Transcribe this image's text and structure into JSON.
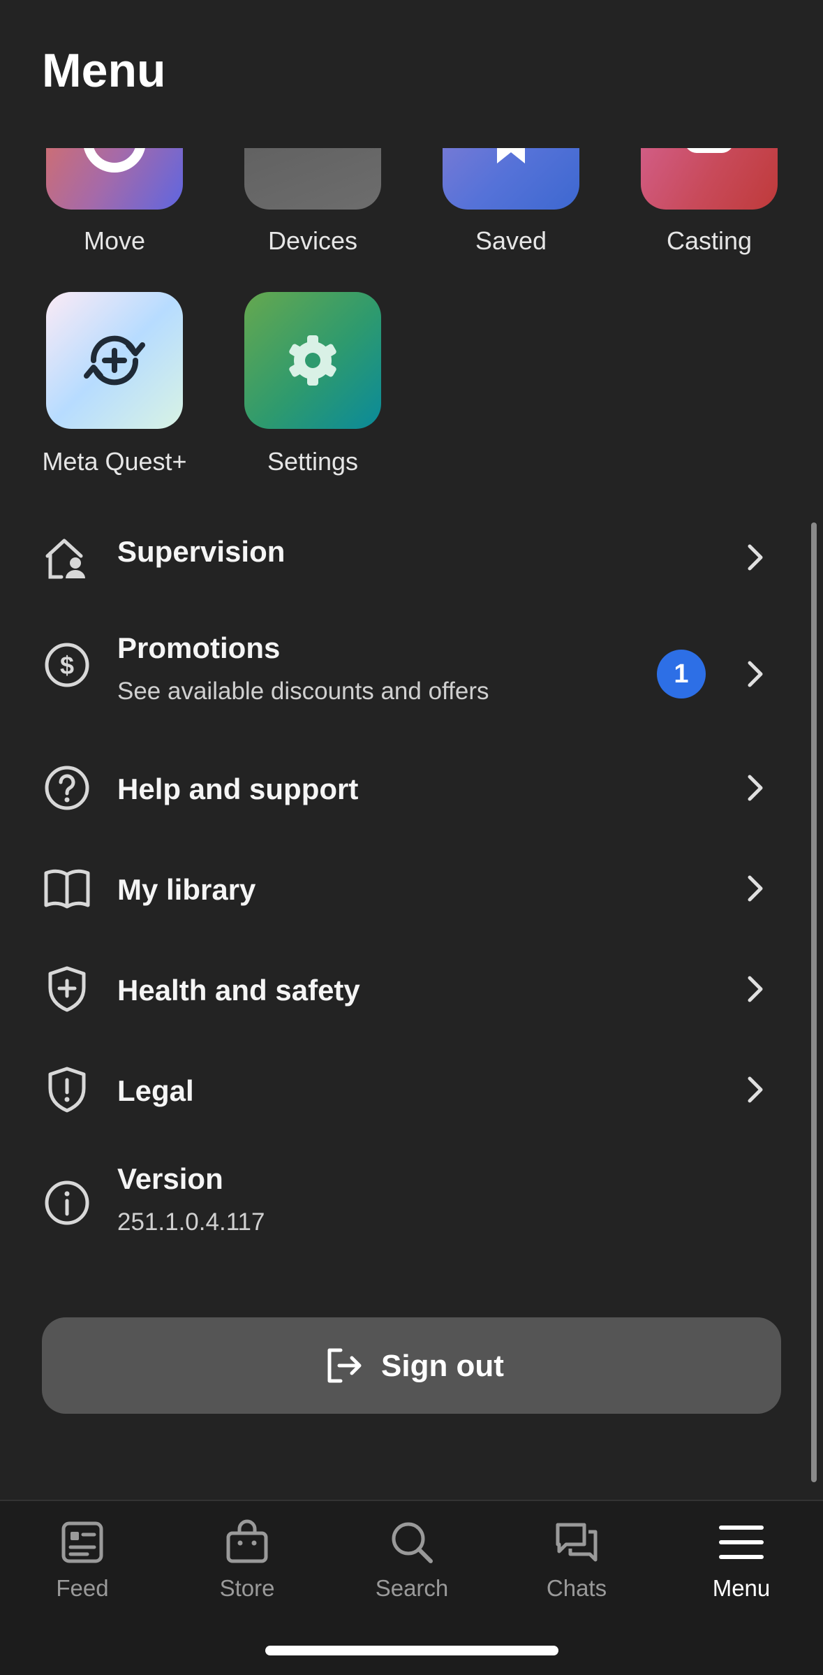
{
  "header": {
    "title": "Menu"
  },
  "apps": [
    {
      "label": "Move",
      "icon": "move-icon"
    },
    {
      "label": "Devices",
      "icon": "headset-icon"
    },
    {
      "label": "Saved",
      "icon": "bookmark-icon"
    },
    {
      "label": "Casting",
      "icon": "cast-icon"
    },
    {
      "label": "Meta Quest+",
      "icon": "meta-quest-plus-icon"
    },
    {
      "label": "Settings",
      "icon": "gear-icon"
    }
  ],
  "menu": {
    "supervision": {
      "title": "Supervision"
    },
    "promotions": {
      "title": "Promotions",
      "subtitle": "See available discounts and offers",
      "badge": "1"
    },
    "help": {
      "title": "Help and support"
    },
    "library": {
      "title": "My library"
    },
    "health": {
      "title": "Health and safety"
    },
    "legal": {
      "title": "Legal"
    },
    "version": {
      "title": "Version",
      "value": "251.1.0.4.117"
    }
  },
  "signout": {
    "label": "Sign out"
  },
  "tabs": [
    {
      "label": "Feed",
      "icon": "feed-icon"
    },
    {
      "label": "Store",
      "icon": "store-icon"
    },
    {
      "label": "Search",
      "icon": "search-icon"
    },
    {
      "label": "Chats",
      "icon": "chats-icon"
    },
    {
      "label": "Menu",
      "icon": "menu-icon",
      "active": true
    }
  ],
  "colors": {
    "accent": "#2d6fe6",
    "background": "#232323",
    "tabbar": "#1c1c1c"
  }
}
